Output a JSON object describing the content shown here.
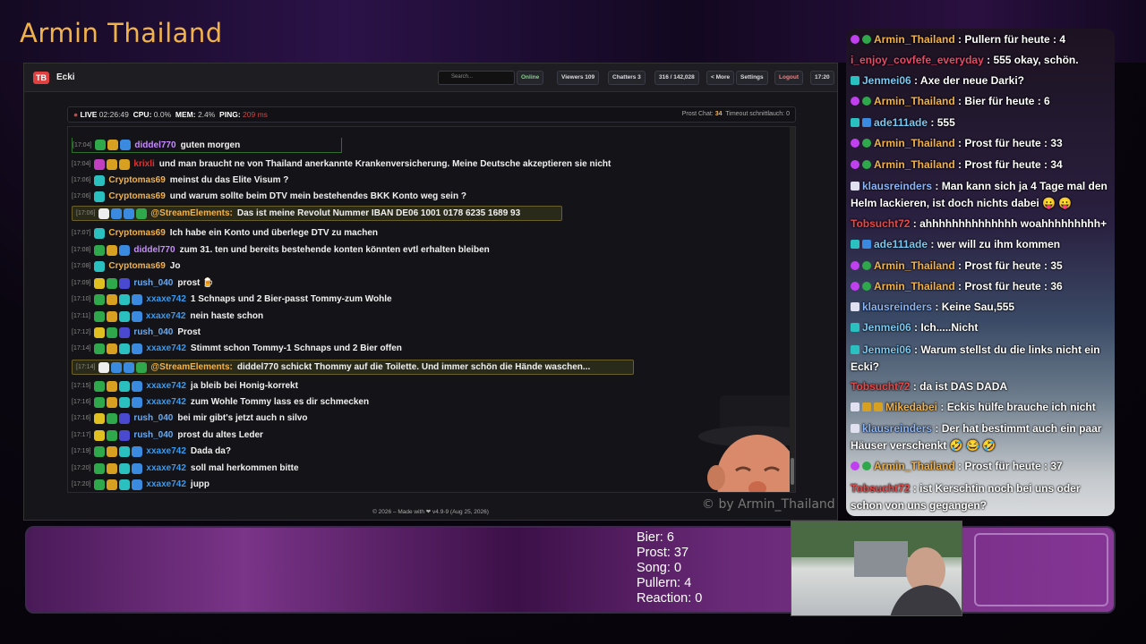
{
  "overlay": {
    "brand": "Armin Thailand",
    "watermark": "© by Armin_Thailand"
  },
  "app": {
    "channel": "Ecki",
    "search_placeholder": "Search...",
    "toolbar": [
      {
        "id": "online",
        "label": "Online"
      },
      {
        "id": "viewers",
        "label": "Viewers 109"
      },
      {
        "id": "chatters",
        "label": "Chatters 3"
      },
      {
        "id": "messages",
        "label": "316 / 142,028"
      },
      {
        "id": "more",
        "label": "< More"
      },
      {
        "id": "settings",
        "label": "Settings"
      },
      {
        "id": "logout",
        "label": "Logout"
      },
      {
        "id": "clock",
        "label": "17:20"
      }
    ],
    "status": {
      "live": "LIVE",
      "uptime": "02:26:49",
      "cpu_label": "CPU:",
      "cpu": "0.0%",
      "mem_label": "MEM:",
      "mem": "2.4%",
      "ping_label": "PING:",
      "ping": "209 ms",
      "prost_label": "Prost Chat:",
      "prost": "34",
      "timeout_label": "Timeout schnittlauch:",
      "timeout": "0"
    },
    "footer": "© 2026 – Made with ❤ v4.9-9 (Aug 25, 2026)",
    "messages": [
      {
        "ts": "[17:04]",
        "name": "diddel770",
        "color": "#c78bff",
        "text": "guten morgen",
        "badges": [
          "#2ea84a",
          "#d8a020",
          "#3a8ae0"
        ]
      },
      {
        "ts": "[17:04]",
        "name": "krixli",
        "color": "#e03030",
        "text": "und man braucht ne von Thailand anerkannte Krankenversicherung. Meine Deutsche akzeptieren sie nicht",
        "badges": [
          "#c040c0",
          "#d8a020",
          "#d8a020"
        ]
      },
      {
        "ts": "[17:06]",
        "name": "Cryptomas69",
        "color": "#f2b24a",
        "text": "meinst du das Elite Visum ?",
        "badges": [
          "#2ac0c0"
        ]
      },
      {
        "ts": "[17:06]",
        "name": "Cryptomas69",
        "color": "#f2b24a",
        "text": "und warum sollte beim DTV mein bestehendes BKK Konto weg sein ?",
        "badges": [
          "#2ac0c0"
        ]
      },
      {
        "ts": "[17:06]",
        "name": "@StreamElements:",
        "color": "#f2b24a",
        "text": "Das ist meine Revolut Nummer IBAN DE06 1001 0178 6235 1689 93",
        "badges": [
          "#eee",
          "#3a8ae0",
          "#3a8ae0",
          "#2ea84a"
        ],
        "hl": true
      },
      {
        "ts": "[17:07]",
        "name": "Cryptomas69",
        "color": "#f2b24a",
        "text": "Ich habe ein Konto und überlege DTV zu machen",
        "badges": [
          "#2ac0c0"
        ]
      },
      {
        "ts": "[17:08]",
        "name": "diddel770",
        "color": "#c78bff",
        "text": "zum 31. ten und bereits bestehende konten könnten evtl erhalten bleiben",
        "badges": [
          "#2ea84a",
          "#d8a020",
          "#3a8ae0"
        ]
      },
      {
        "ts": "[17:08]",
        "name": "Cryptomas69",
        "color": "#f2b24a",
        "text": "Jo",
        "badges": [
          "#2ac0c0"
        ]
      },
      {
        "ts": "[17:09]",
        "name": "rush_040",
        "color": "#6aaaf0",
        "text": "prost 🍺",
        "badges": [
          "#e0c020",
          "#2ea84a",
          "#4a4ad0"
        ]
      },
      {
        "ts": "[17:10]",
        "name": "xxaxe742",
        "color": "#3a9af0",
        "text": "1 Schnaps und 2 Bier-passt Tommy-zum Wohle",
        "badges": [
          "#2ea84a",
          "#d8a020",
          "#2ac0c0",
          "#3a8ae0"
        ]
      },
      {
        "ts": "[17:11]",
        "name": "xxaxe742",
        "color": "#3a9af0",
        "text": "nein haste schon",
        "badges": [
          "#2ea84a",
          "#d8a020",
          "#2ac0c0",
          "#3a8ae0"
        ]
      },
      {
        "ts": "[17:12]",
        "name": "rush_040",
        "color": "#6aaaf0",
        "text": "Prost",
        "badges": [
          "#e0c020",
          "#2ea84a",
          "#4a4ad0"
        ]
      },
      {
        "ts": "[17:14]",
        "name": "xxaxe742",
        "color": "#3a9af0",
        "text": "Stimmt schon Tommy-1 Schnaps und 2 Bier offen",
        "badges": [
          "#2ea84a",
          "#d8a020",
          "#2ac0c0",
          "#3a8ae0"
        ]
      },
      {
        "ts": "[17:14]",
        "name": "@StreamElements:",
        "color": "#f2b24a",
        "text": "diddel770 schickt Thommy auf die Toilette. Und immer schön die Hände waschen...",
        "badges": [
          "#eee",
          "#3a8ae0",
          "#3a8ae0",
          "#2ea84a"
        ],
        "hl": true
      },
      {
        "ts": "[17:15]",
        "name": "xxaxe742",
        "color": "#3a9af0",
        "text": "ja bleib bei Honig-korrekt",
        "badges": [
          "#2ea84a",
          "#d8a020",
          "#2ac0c0",
          "#3a8ae0"
        ]
      },
      {
        "ts": "[17:16]",
        "name": "xxaxe742",
        "color": "#3a9af0",
        "text": "zum Wohle Tommy lass es dir schmecken",
        "badges": [
          "#2ea84a",
          "#d8a020",
          "#2ac0c0",
          "#3a8ae0"
        ]
      },
      {
        "ts": "[17:16]",
        "name": "rush_040",
        "color": "#6aaaf0",
        "text": "bei mir gibt's jetzt auch n silvo",
        "badges": [
          "#e0c020",
          "#2ea84a",
          "#4a4ad0"
        ]
      },
      {
        "ts": "[17:17]",
        "name": "rush_040",
        "color": "#6aaaf0",
        "text": "prost du altes Leder",
        "badges": [
          "#e0c020",
          "#2ea84a",
          "#4a4ad0"
        ]
      },
      {
        "ts": "[17:19]",
        "name": "xxaxe742",
        "color": "#3a9af0",
        "text": "Dada da?",
        "badges": [
          "#2ea84a",
          "#d8a020",
          "#2ac0c0",
          "#3a8ae0"
        ]
      },
      {
        "ts": "[17:20]",
        "name": "xxaxe742",
        "color": "#3a9af0",
        "text": "soll mal herkommen bitte",
        "badges": [
          "#2ea84a",
          "#d8a020",
          "#2ac0c0",
          "#3a8ae0"
        ]
      },
      {
        "ts": "[17:20]",
        "name": "xxaxe742",
        "color": "#3a9af0",
        "text": "jupp",
        "badges": [
          "#2ea84a",
          "#d8a020",
          "#2ac0c0",
          "#3a8ae0"
        ]
      }
    ]
  },
  "stream_chat": [
    {
      "name": "Armin_Thailand",
      "color": "#f2b24a",
      "text": ": Pullern für heute : 4",
      "icons": [
        "#c040f0",
        "#2ea84a"
      ]
    },
    {
      "name": "i_enjoy_covfefe_everyday",
      "color": "#e84a6a",
      "text": ": 555 okay, schön.",
      "icons": []
    },
    {
      "name": "Jenmei06",
      "color": "#7ac8f0",
      "text": ": Axe der neue Darki?",
      "icons": [
        "#2ac0c0"
      ]
    },
    {
      "name": "Armin_Thailand",
      "color": "#f2b24a",
      "text": ": Bier für heute : 6",
      "icons": [
        "#c040f0",
        "#2ea84a"
      ]
    },
    {
      "name": "ade111ade",
      "color": "#7ac8f0",
      "text": ": 555",
      "icons": [
        "#2ac0c0",
        "#3a8ae0"
      ]
    },
    {
      "name": "Armin_Thailand",
      "color": "#f2b24a",
      "text": ": Prost für heute : 33",
      "icons": [
        "#c040f0",
        "#2ea84a"
      ]
    },
    {
      "name": "Armin_Thailand",
      "color": "#f2b24a",
      "text": ": Prost für heute : 34",
      "icons": [
        "#c040f0",
        "#2ea84a"
      ]
    },
    {
      "name": "klausreinders",
      "color": "#8ab4f8",
      "text": ": Man kann sich ja 4 Tage mal den Helm lackieren, ist doch nichts dabei 😛 😛",
      "icons": [
        "#e0e0f0"
      ]
    },
    {
      "name": "Tobsucht72",
      "color": "#e84a4a",
      "text": ": ahhhhhhhhhhhhhh woahhhhhhhhh+",
      "icons": []
    },
    {
      "name": "ade111ade",
      "color": "#7ac8f0",
      "text": ": wer will zu ihm kommen",
      "icons": [
        "#2ac0c0",
        "#3a8ae0"
      ]
    },
    {
      "name": "Armin_Thailand",
      "color": "#f2b24a",
      "text": ": Prost für heute : 35",
      "icons": [
        "#c040f0",
        "#2ea84a"
      ]
    },
    {
      "name": "Armin_Thailand",
      "color": "#f2b24a",
      "text": ": Prost für heute : 36",
      "icons": [
        "#c040f0",
        "#2ea84a"
      ]
    },
    {
      "name": "klausreinders",
      "color": "#8ab4f8",
      "text": ": Keine Sau,555",
      "icons": [
        "#e0e0f0"
      ]
    },
    {
      "name": "Jenmei06",
      "color": "#7ac8f0",
      "text": ": Ich.....Nicht",
      "icons": [
        "#2ac0c0"
      ]
    },
    {
      "name": "Jenmei06",
      "color": "#7ac8f0",
      "text": ": Warum stellst du die links nicht ein Ecki?",
      "icons": [
        "#2ac0c0"
      ]
    },
    {
      "name": "Tobsucht72",
      "color": "#e84a4a",
      "text": ": da ist DAS DADA",
      "icons": []
    },
    {
      "name": "Mikedabei",
      "color": "#f2b24a",
      "text": ": Eckis hülfe brauche ich nicht",
      "icons": [
        "#e0e0f0",
        "#d8a020",
        "#d8a020"
      ]
    },
    {
      "name": "klausreinders",
      "color": "#8ab4f8",
      "text": ": Der hat bestimmt auch ein paar Häuser verschenkt 🤣 😂 🤣",
      "icons": [
        "#e0e0f0"
      ]
    },
    {
      "name": "Armin_Thailand",
      "color": "#f2b24a",
      "text": ": Prost für heute : 37",
      "icons": [
        "#c040f0",
        "#2ea84a"
      ]
    },
    {
      "name": "Tobsucht72",
      "color": "#e84a4a",
      "text": ": ist Kerschtin noch bei uns oder schon von uns gegangen?",
      "icons": []
    }
  ],
  "counters": [
    {
      "label": "Bier:",
      "value": "6"
    },
    {
      "label": "Prost:",
      "value": "37"
    },
    {
      "label": "Song:",
      "value": "0"
    },
    {
      "label": "Pullern:",
      "value": "4"
    },
    {
      "label": "Reaction:",
      "value": "0"
    }
  ]
}
